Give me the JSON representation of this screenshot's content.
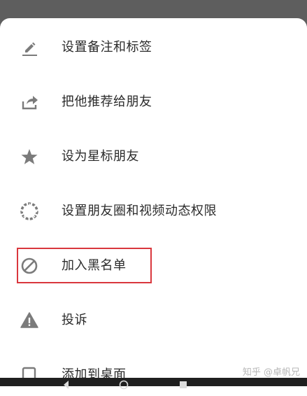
{
  "menu": {
    "items": [
      {
        "label": "设置备注和标签",
        "icon": "edit-pencil-icon"
      },
      {
        "label": "把他推荐给朋友",
        "icon": "share-forward-icon"
      },
      {
        "label": "设为星标朋友",
        "icon": "star-icon"
      },
      {
        "label": "设置朋友圈和视频动态权限",
        "icon": "moments-aperture-icon"
      },
      {
        "label": "加入黑名单",
        "icon": "block-circle-icon"
      },
      {
        "label": "投诉",
        "icon": "warning-triangle-icon"
      },
      {
        "label": "添加到桌面",
        "icon": "add-to-desktop-icon"
      }
    ]
  },
  "highlight": {
    "target": "加入黑名单",
    "color": "#d9373d"
  },
  "watermark": {
    "text": "知乎 @卓帆兄"
  },
  "colors": {
    "icon": "#7b7b7b",
    "text": "#2b2b2b",
    "sheet": "#ffffff",
    "scrim": "#5e5e5e"
  }
}
